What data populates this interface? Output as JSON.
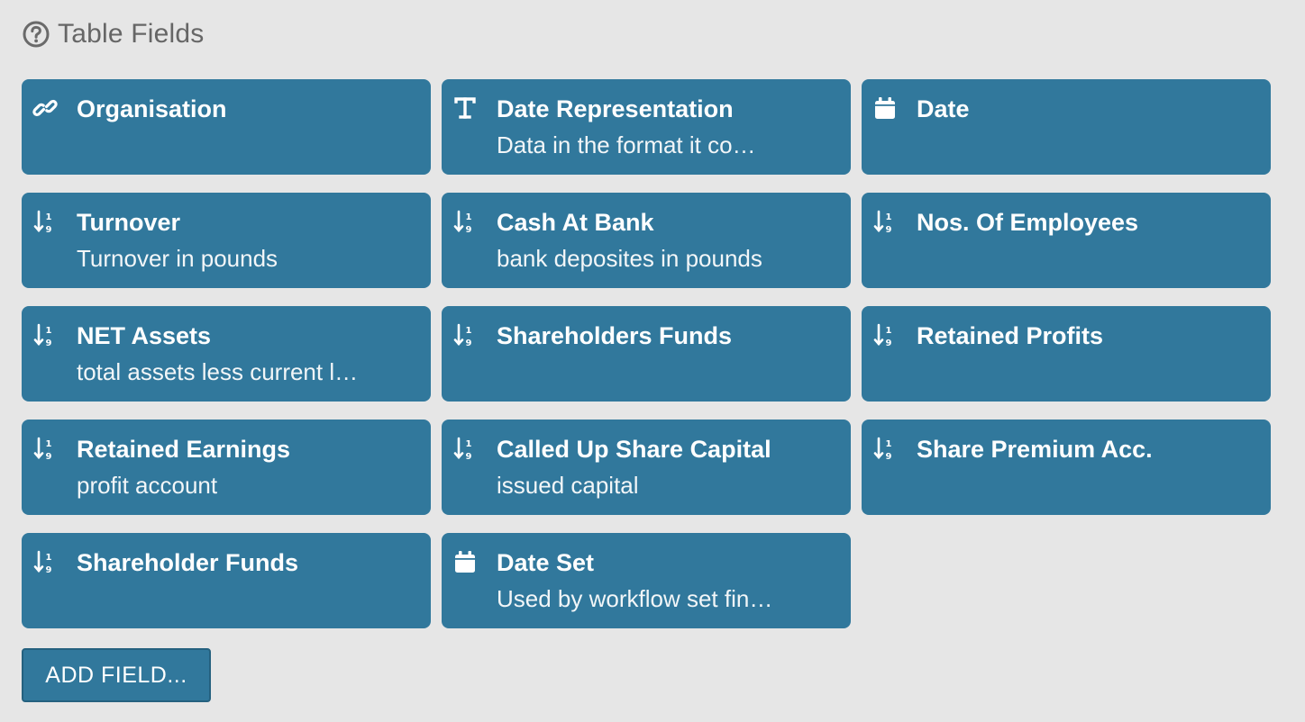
{
  "header": {
    "title": "Table Fields",
    "icon": "help-circle-icon"
  },
  "fields": [
    {
      "name": "Organisation",
      "description": "",
      "icon": "link-icon"
    },
    {
      "name": "Date Representation",
      "description": "Data in the format it co…",
      "icon": "text-icon"
    },
    {
      "name": "Date",
      "description": "",
      "icon": "calendar-icon"
    },
    {
      "name": "Turnover",
      "description": "Turnover in pounds",
      "icon": "number-icon"
    },
    {
      "name": "Cash At Bank",
      "description": "bank deposites in pounds",
      "icon": "number-icon"
    },
    {
      "name": "Nos. Of Employees",
      "description": "",
      "icon": "number-icon"
    },
    {
      "name": "NET Assets",
      "description": "total assets less current l…",
      "icon": "number-icon"
    },
    {
      "name": "Shareholders Funds",
      "description": "",
      "icon": "number-icon"
    },
    {
      "name": "Retained Profits",
      "description": "",
      "icon": "number-icon"
    },
    {
      "name": "Retained Earnings",
      "description": "profit account",
      "icon": "number-icon"
    },
    {
      "name": "Called Up Share Capital",
      "description": "issued capital",
      "icon": "number-icon"
    },
    {
      "name": "Share Premium Acc.",
      "description": "",
      "icon": "number-icon"
    },
    {
      "name": "Shareholder Funds",
      "description": "",
      "icon": "number-icon"
    },
    {
      "name": "Date Set",
      "description": "Used by workflow set fin…",
      "icon": "calendar-icon"
    }
  ],
  "actions": {
    "add_field_label": "ADD FIELD..."
  },
  "colors": {
    "card": "#31789c",
    "background": "#e6e6e6",
    "header_text": "#666666"
  }
}
